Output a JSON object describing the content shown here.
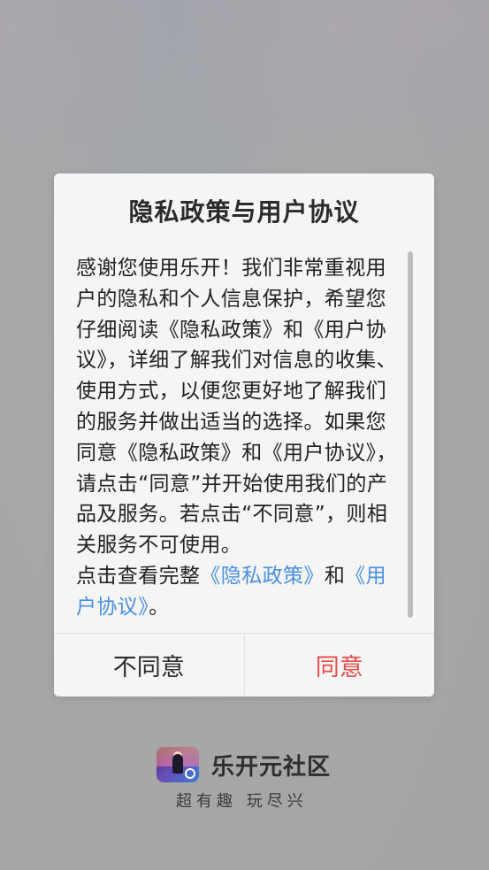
{
  "dialog": {
    "title": "隐私政策与用户协议",
    "body_text": "感谢您使用乐开！我们非常重视用户的隐私和个人信息保护，希望您仔细阅读《隐私政策》和《用户协议》，详细了解我们对信息的收集、使用方式，以便您更好地了解我们的服务并做出适当的选择。如果您同意《隐私政策》和《用户协议》，请点击“同意”并开始使用我们的产品及服务。若点击“不同意”，则相关服务不可使用。",
    "view_prefix": "点击查看完整",
    "privacy_link": "《隐私政策》",
    "and_text": "和",
    "agreement_link": "《用户协议》",
    "end_punct": "。",
    "disagree_label": "不同意",
    "agree_label": "同意"
  },
  "brand": {
    "app_name": "乐开元社区",
    "slogan": "超有趣 玩尽兴"
  },
  "colors": {
    "agree": "#e74c4c",
    "link": "#4a90e2"
  }
}
